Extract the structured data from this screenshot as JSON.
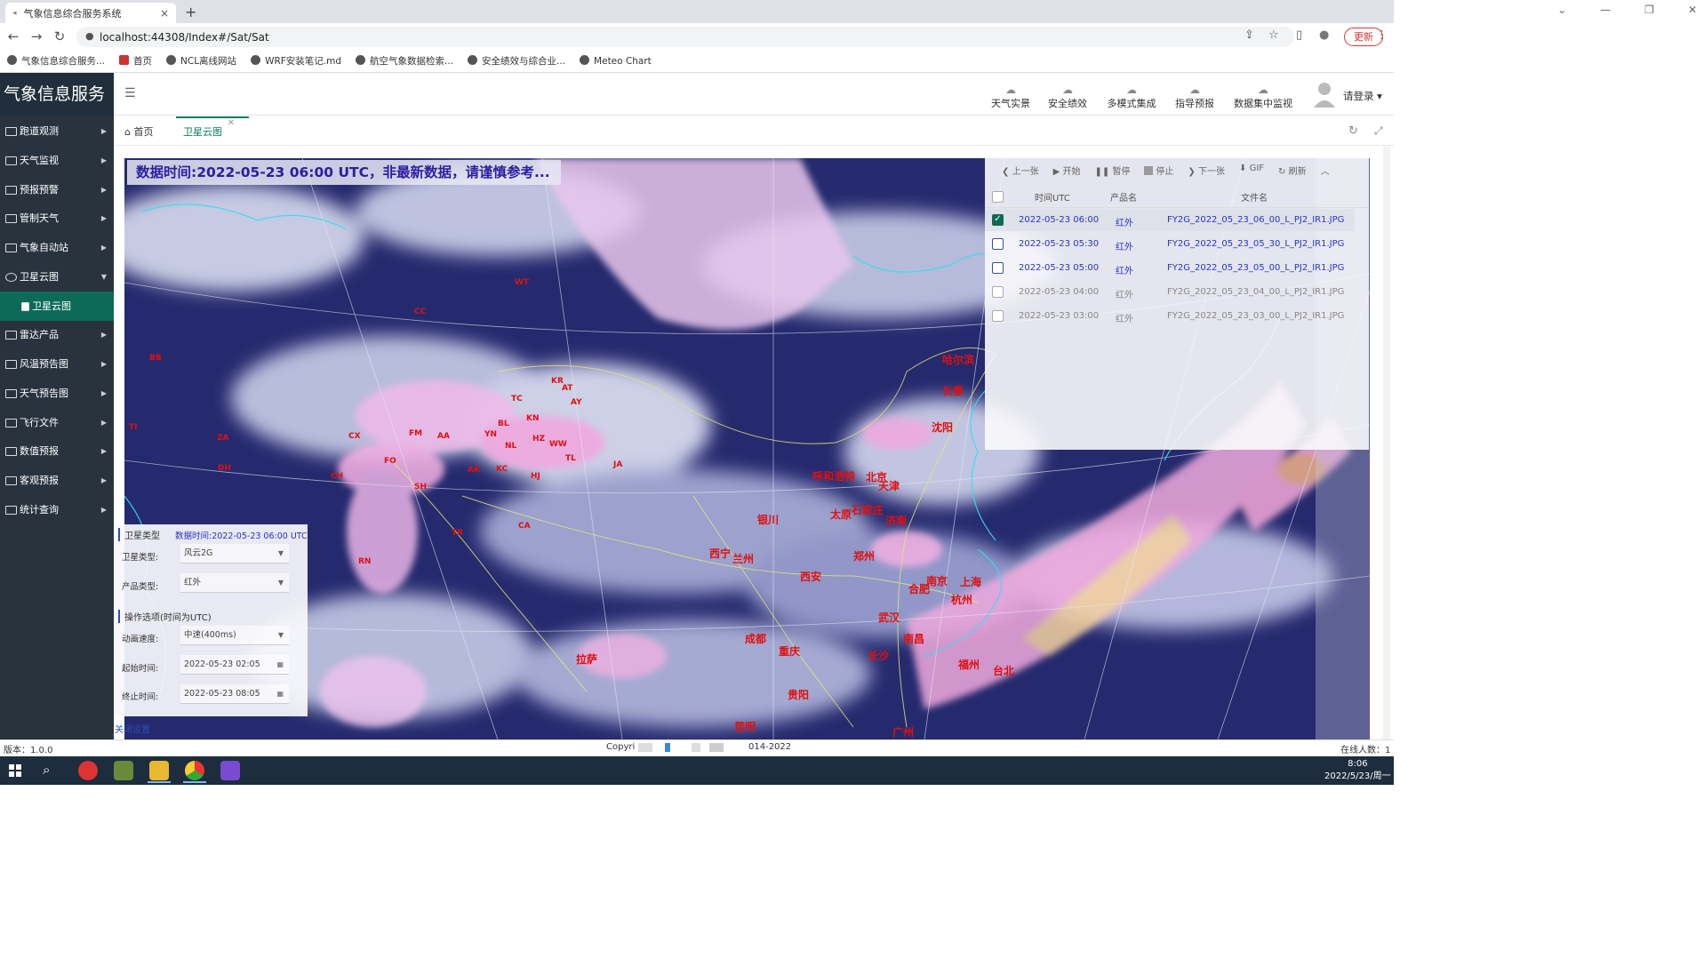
{
  "browser": {
    "tab_title": "气象信息综合服务系统",
    "tab_close": "×",
    "new_tab": "+",
    "url": "localhost:44308/Index#/Sat/Sat",
    "update_label": "更新",
    "bookmarks": [
      "气象信息综合服务...",
      "首页",
      "NCL离线网站",
      "WRF安装笔记.md",
      "航空气象数据检索...",
      "安全绩效与综合业...",
      "Meteo Chart"
    ]
  },
  "app": {
    "title": "气象信息服务",
    "top_nav": [
      "天气实景",
      "安全绩效",
      "多模式集成",
      "指导预报",
      "数据集中监视"
    ],
    "login": "请登录"
  },
  "sidebar": {
    "items": [
      "跑道观测",
      "天气监视",
      "预报预警",
      "管制天气",
      "气象自动站",
      "卫星云图",
      "雷达产品",
      "风温预告图",
      "天气预告图",
      "飞行文件",
      "数值预报",
      "客观预报",
      "统计查询"
    ],
    "sub_item": "卫星云图"
  },
  "tabs": {
    "home": "首页",
    "active": "卫星云图"
  },
  "map": {
    "data_time_banner": "数据时间:2022-05-23 06:00 UTC，非最新数据，请谨慎参考...",
    "city_labels": [
      "哈尔滨",
      "长春",
      "沈阳",
      "呼和浩特",
      "北京",
      "天津",
      "石家庄",
      "太原",
      "济南",
      "银川",
      "兰州",
      "西宁",
      "郑州",
      "西安",
      "合肥",
      "南京",
      "上海",
      "杭州",
      "武汉",
      "南昌",
      "长沙",
      "福州",
      "台北",
      "成都",
      "重庆",
      "贵阳",
      "昆明",
      "拉萨",
      "广州"
    ],
    "station_codes": [
      "BB",
      "CC",
      "WT",
      "TC",
      "BL",
      "KR",
      "AT",
      "YN",
      "KN",
      "HZ",
      "NL",
      "WW",
      "TL",
      "KC",
      "AK",
      "HJ",
      "SH",
      "FO",
      "FM",
      "AA",
      "CX",
      "JA",
      "TR",
      "CA",
      "RN",
      "TI",
      "ZA",
      "DH",
      "CH",
      "AY"
    ]
  },
  "file_panel": {
    "toolbar": [
      "上一张",
      "开始",
      "暂停",
      "停止",
      "下一张",
      "GIF",
      "刷新"
    ],
    "headers": [
      "时间UTC",
      "产品名",
      "文件名"
    ],
    "rows": [
      {
        "time": "2022-05-23 06:00",
        "product": "红外",
        "file": "FY2G_2022_05_23_06_00_L_PJ2_IR1.JPG",
        "checked": true
      },
      {
        "time": "2022-05-23 05:30",
        "product": "红外",
        "file": "FY2G_2022_05_23_05_30_L_PJ2_IR1.JPG",
        "checked": false
      },
      {
        "time": "2022-05-23 05:00",
        "product": "红外",
        "file": "FY2G_2022_05_23_05_00_L_PJ2_IR1.JPG",
        "checked": false
      },
      {
        "time": "2022-05-23 04:00",
        "product": "红外",
        "file": "FY2G_2022_05_23_04_00_L_PJ2_IR1.JPG",
        "checked": false
      },
      {
        "time": "2022-05-23 03:00",
        "product": "红外",
        "file": "FY2G_2022_05_23_03_00_L_PJ2_IR1.JPG",
        "checked": false
      }
    ]
  },
  "settings_panel": {
    "section1": "卫星类型",
    "data_time": "数据时间:2022-05-23 06:00 UTC",
    "sat_type_label": "卫星类型:",
    "sat_type_value": "风云2G",
    "product_label": "产品类型:",
    "product_value": "红外",
    "section2": "操作选项(时间为UTC)",
    "speed_label": "动画速度:",
    "speed_value": "中速(400ms)",
    "start_label": "起始时间:",
    "start_value": "2022-05-23 02:05",
    "end_label": "终止时间:",
    "end_value": "2022-05-23 08:05",
    "close_label": "关闭设置"
  },
  "footer": {
    "version": "版本：1.0.0",
    "copyright_left": "Copyri",
    "copyright_right": "014-2022",
    "online": "在线人数：1"
  },
  "taskbar": {
    "time": "8:06",
    "date": "2022/5/23/周一"
  }
}
